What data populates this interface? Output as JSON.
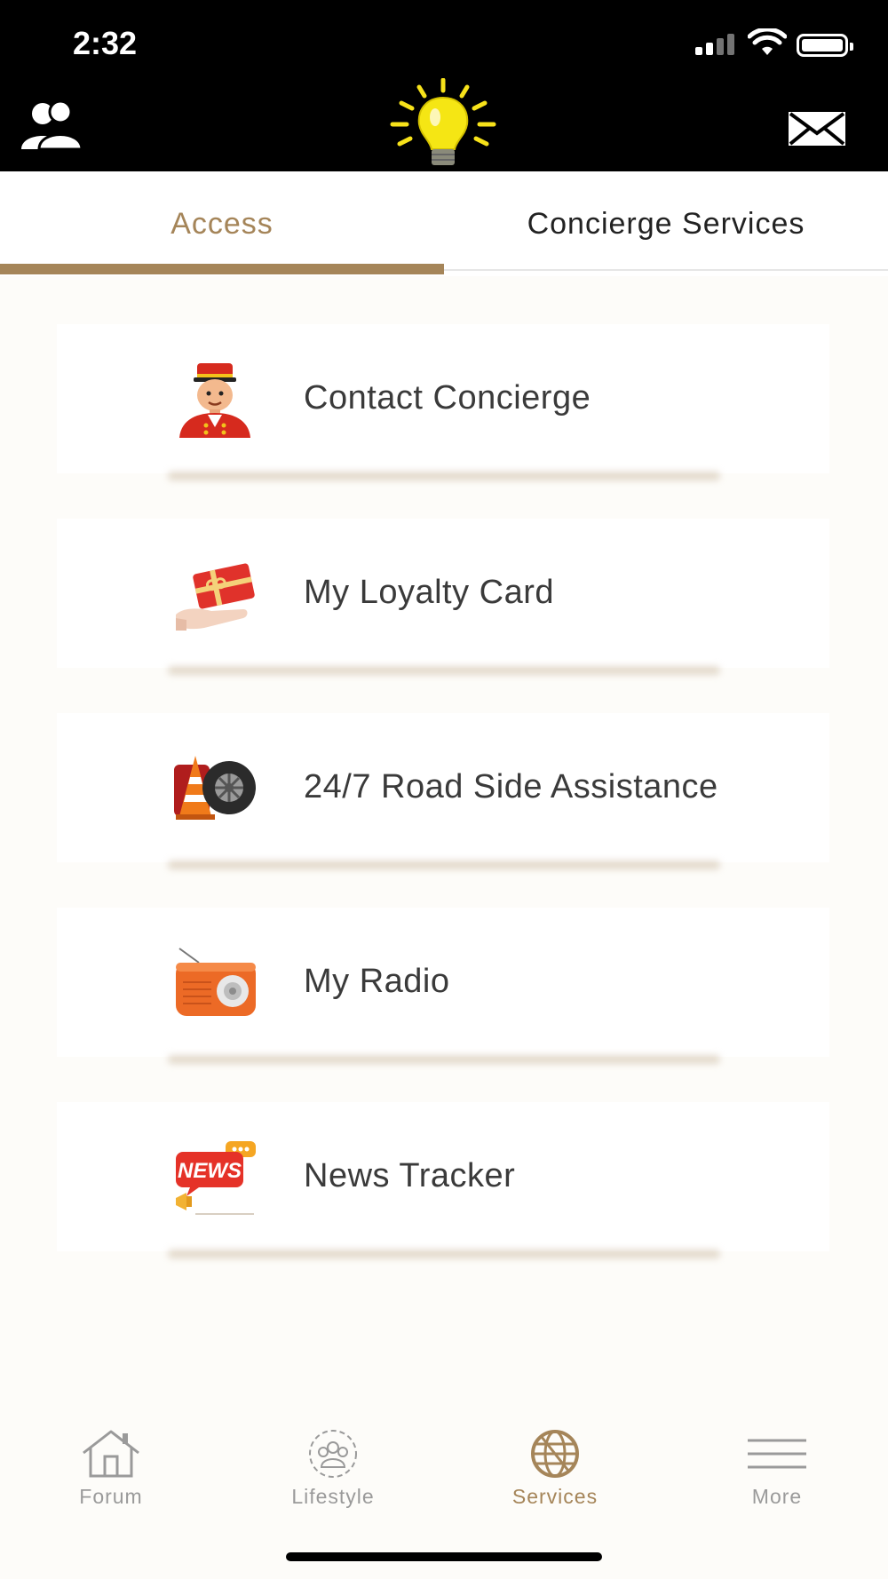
{
  "status_bar": {
    "time": "2:32"
  },
  "header": {
    "left_icon": "users-icon",
    "logo_icon": "lightbulb-icon",
    "right_icon": "mail-icon"
  },
  "tabs": [
    {
      "label": "Access",
      "active": true
    },
    {
      "label": "Concierge Services",
      "active": false
    }
  ],
  "services": [
    {
      "label": "Contact Concierge",
      "icon": "bellboy-icon"
    },
    {
      "label": "My Loyalty Card",
      "icon": "gift-card-icon"
    },
    {
      "label": "24/7 Road Side Assistance",
      "icon": "roadside-icon"
    },
    {
      "label": "My Radio",
      "icon": "radio-icon"
    },
    {
      "label": "News Tracker",
      "icon": "news-icon",
      "icon_text": "NEWS"
    }
  ],
  "bottom_nav": [
    {
      "label": "Forum",
      "icon": "home-icon",
      "active": false
    },
    {
      "label": "Lifestyle",
      "icon": "people-circle-icon",
      "active": false
    },
    {
      "label": "Services",
      "icon": "globe-icon",
      "active": true
    },
    {
      "label": "More",
      "icon": "menu-icon",
      "active": false
    }
  ],
  "colors": {
    "accent": "#a58559",
    "header_bg": "#000000",
    "page_bg": "#fdfcf9"
  }
}
